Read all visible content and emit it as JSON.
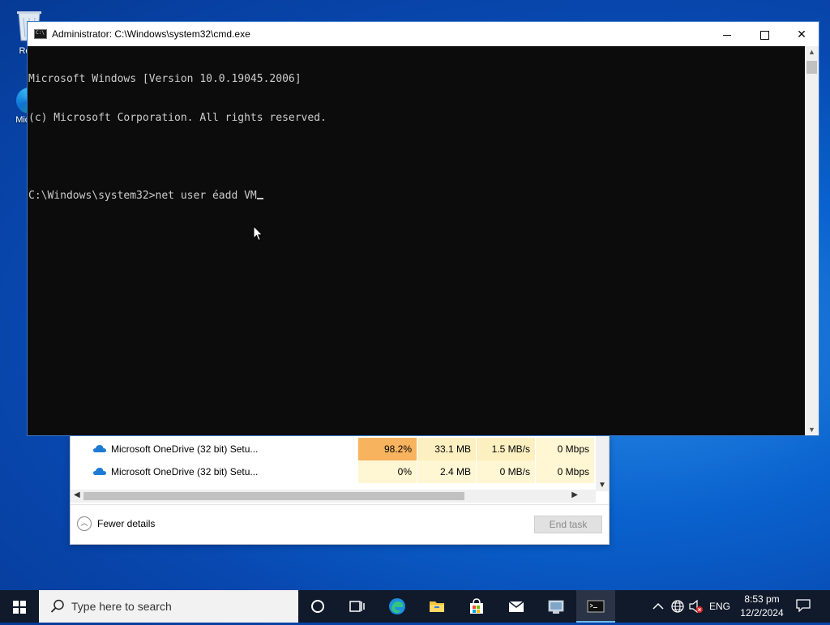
{
  "desktop": {
    "icons": [
      {
        "label": "Recy"
      },
      {
        "label": "Mic Ed"
      }
    ]
  },
  "task_manager": {
    "rows": [
      {
        "name": "Microsoft OneDrive (32 bit) Setu...",
        "cpu": "98.2%",
        "memory": "33.1 MB",
        "disk": "1.5 MB/s",
        "network": "0 Mbps"
      },
      {
        "name": "Microsoft OneDrive (32 bit) Setu...",
        "cpu": "0%",
        "memory": "2.4 MB",
        "disk": "0 MB/s",
        "network": "0 Mbps"
      }
    ],
    "fewer_details": "Fewer details",
    "end_task": "End task"
  },
  "cmd": {
    "title": "Administrator: C:\\Windows\\system32\\cmd.exe",
    "lines": [
      "Microsoft Windows [Version 10.0.19045.2006]",
      "(c) Microsoft Corporation. All rights reserved.",
      "",
      "C:\\Windows\\system32>net user éadd VM"
    ]
  },
  "taskbar": {
    "search_placeholder": "Type here to search",
    "apps": [
      "cortana-icon",
      "task-view-icon",
      "edge-icon",
      "file-explorer-icon",
      "store-icon",
      "mail-icon",
      "network-app-icon",
      "cmd-icon"
    ],
    "language": "ENG",
    "time": "8:53 pm",
    "date": "12/2/2024"
  }
}
